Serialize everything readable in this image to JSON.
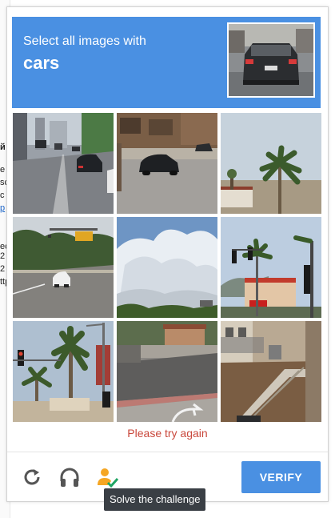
{
  "background_page": {
    "fragments": [
      "й",
      "e",
      "sc",
      "c",
      "p",
      "ip",
      "ec",
      "2",
      "2",
      "ttp"
    ]
  },
  "challenge": {
    "header": {
      "instruction": "Select all images with",
      "target": "cars"
    },
    "tiles": [
      {
        "scene": "city-street-cars"
      },
      {
        "scene": "street-parked-car"
      },
      {
        "scene": "palm-tree-building"
      },
      {
        "scene": "highway-trees"
      },
      {
        "scene": "cloudy-sky"
      },
      {
        "scene": "palm-traffic-light"
      },
      {
        "scene": "traffic-light-palm"
      },
      {
        "scene": "sidewalk-road"
      },
      {
        "scene": "stairs-fence"
      }
    ],
    "error_message": "Please try again",
    "footer": {
      "reload_icon": "reload-icon",
      "audio_icon": "headphones-icon",
      "help_icon": "person-check-icon",
      "verify_label": "VERIFY"
    },
    "tooltip": "Solve the challenge"
  },
  "colors": {
    "accent": "#4a90e2",
    "error": "#c9473b",
    "tooltip_bg": "#3a3f45",
    "help_icon_orange": "#f5a623",
    "help_icon_green": "#1fa463"
  }
}
